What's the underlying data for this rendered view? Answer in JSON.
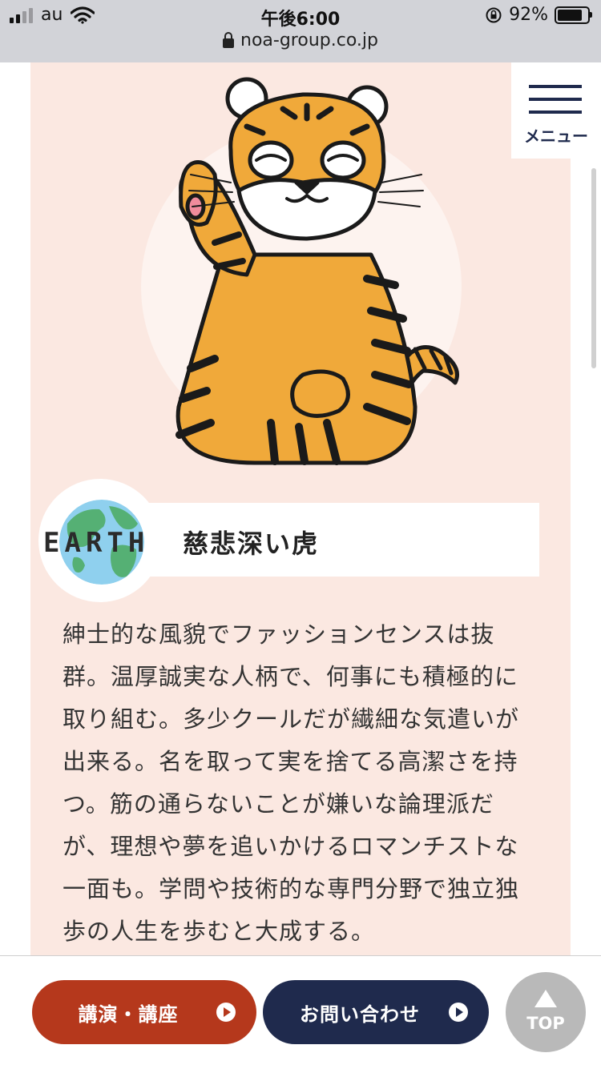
{
  "status_bar": {
    "carrier": "au",
    "time": "午後6:00",
    "battery_percent": "92%",
    "url": "noa-group.co.jp"
  },
  "header": {
    "menu_label": "メニュー"
  },
  "profile": {
    "element_label": "EARTH",
    "title": "慈悲深い虎",
    "description_lines": [
      "紳士的な風貌でファッションセンスは抜",
      "群。温厚誠実な人柄で、何事にも積極的に",
      "取り組む。多少クールだが繊細な気遣いが",
      "出来る。名を取って実を捨てる高潔さを持",
      "つ。筋の通らないことが嫌いな論理派だ",
      "が、理想や夢を追いかけるロマンチストな",
      "一面も。学問や技術的な専門分野で独立独",
      "歩の人生を歩むと大成する。"
    ]
  },
  "bottom_nav": {
    "lecture_label": "講演・講座",
    "contact_label": "お問い合わせ",
    "top_label": "TOP"
  },
  "colors": {
    "panel_bg": "#fbe8e1",
    "lecture_button": "#b5381c",
    "contact_button": "#1f2a4d",
    "top_button": "#b9b9b9",
    "tiger_orange": "#f0a93a"
  },
  "icons": {
    "signal": "signal-bars-icon",
    "wifi": "wifi-icon",
    "lock": "lock-icon",
    "rotation_lock": "rotation-lock-icon",
    "battery": "battery-icon",
    "menu": "hamburger-menu-icon",
    "earth": "globe-icon",
    "play": "play-circle-icon",
    "top": "arrow-up-icon"
  }
}
